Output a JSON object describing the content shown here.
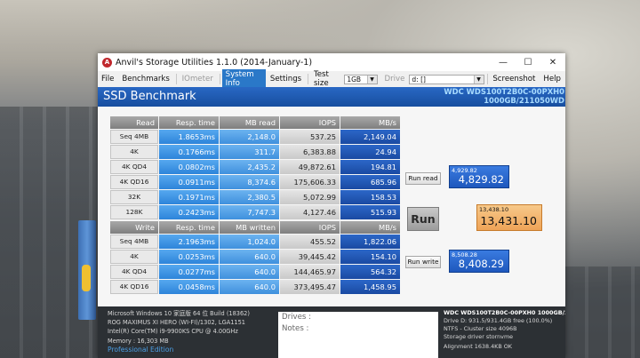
{
  "window": {
    "title": "Anvil's Storage Utilities 1.1.0 (2014-January-1)",
    "minimize": "—",
    "maximize": "☐",
    "close": "✕"
  },
  "menu": {
    "file": "File",
    "benchmarks": "Benchmarks",
    "iometer": "IOmeter",
    "system_info": "System Info",
    "settings": "Settings",
    "test_size_label": "Test size",
    "test_size_value": "1GB",
    "drive_label": "Drive",
    "drive_value": "d: []",
    "screenshot": "Screenshot",
    "help": "Help"
  },
  "header": {
    "title": "SSD Benchmark",
    "drive_model": "WDC WDS100T2B0C-00PXH0",
    "drive_firmware": "1000GB/211050WD"
  },
  "read_table": {
    "headers": [
      "Read",
      "Resp. time",
      "MB read",
      "IOPS",
      "MB/s"
    ],
    "rows": [
      [
        "Seq 4MB",
        "1.8653ms",
        "2,148.0",
        "537.25",
        "2,149.04"
      ],
      [
        "4K",
        "0.1766ms",
        "311.7",
        "6,383.88",
        "24.94"
      ],
      [
        "4K QD4",
        "0.0802ms",
        "2,435.2",
        "49,872.61",
        "194.81"
      ],
      [
        "4K QD16",
        "0.0911ms",
        "8,374.6",
        "175,606.33",
        "685.96"
      ],
      [
        "32K",
        "0.1971ms",
        "2,380.5",
        "5,072.99",
        "158.53"
      ],
      [
        "128K",
        "0.2423ms",
        "7,747.3",
        "4,127.46",
        "515.93"
      ]
    ]
  },
  "write_table": {
    "headers": [
      "Write",
      "Resp. time",
      "MB written",
      "IOPS",
      "MB/s"
    ],
    "rows": [
      [
        "Seq 4MB",
        "2.1963ms",
        "1,024.0",
        "455.52",
        "1,822.06"
      ],
      [
        "4K",
        "0.0253ms",
        "640.0",
        "39,445.42",
        "154.10"
      ],
      [
        "4K QD4",
        "0.0277ms",
        "640.0",
        "144,465.97",
        "564.32"
      ],
      [
        "4K QD16",
        "0.0458ms",
        "640.0",
        "373,495.47",
        "1,458.95"
      ]
    ]
  },
  "buttons": {
    "run_read": "Run read",
    "run": "Run",
    "run_write": "Run write"
  },
  "scores": {
    "read_small": "4,929.82",
    "read_large": "4,829.82",
    "total_small": "13,438.10",
    "total_large": "13,431.10",
    "write_small": "8,508.28",
    "write_large": "8,408.29"
  },
  "system": {
    "os": "Microsoft Windows 10 家庭版 64 位 Build (18362)",
    "board": "ROG MAXIMUS XI HERO (WI-FI)/1302, LGA1151",
    "cpu": "Intel(R) Core(TM) i9-9900KS CPU @ 4.00GHz",
    "memory": "Memory : 16,303 MB",
    "edition": "Professional Edition"
  },
  "notes": {
    "drives_label": "Drives :",
    "notes_label": "Notes :"
  },
  "drive_info": {
    "title": "WDC WDS100T2B0C-00PXH0 1000GB/2",
    "space": "Drive D: 931.5/931.4GB free (100.0%)",
    "fs": "NTFS - Cluster size 4096B",
    "driver": "Storage driver  stornvme",
    "alignment": "Alignment 1638.4KB OK"
  }
}
